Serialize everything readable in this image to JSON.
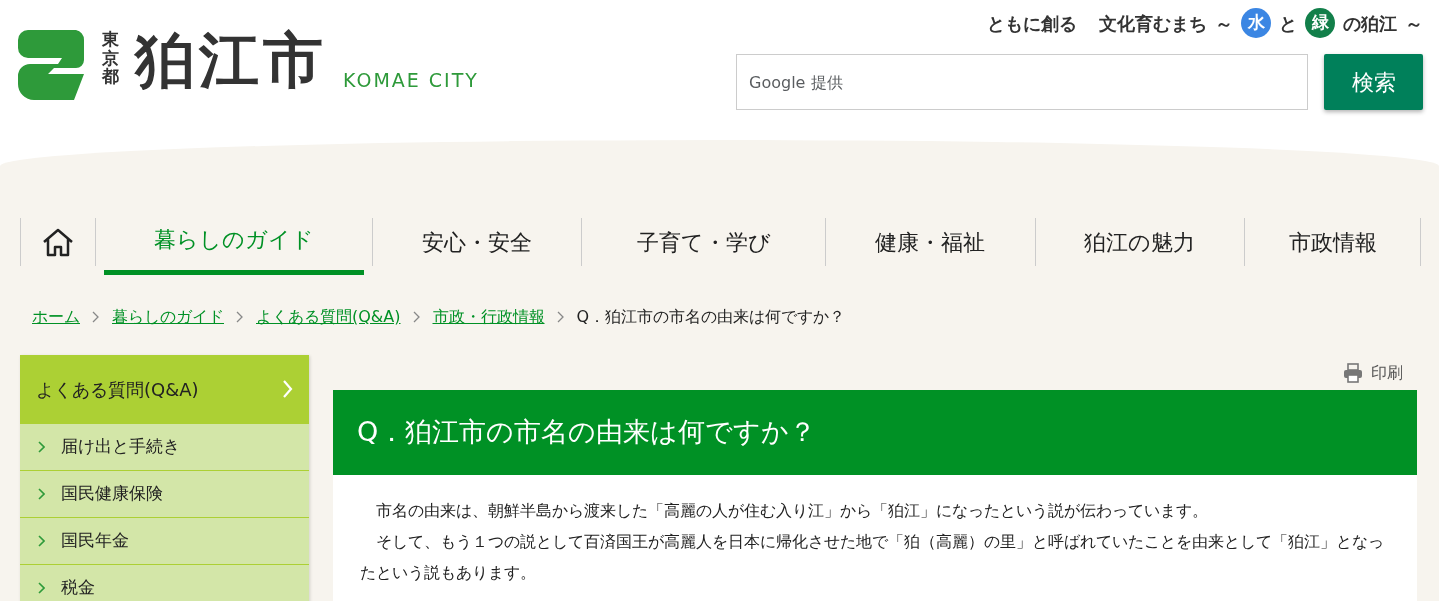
{
  "header": {
    "prefecture": "東京都",
    "city": "狛江市",
    "city_en": "KOMAE CITY",
    "slogan": [
      {
        "kind": "text",
        "text": "ともに創る"
      },
      {
        "kind": "text",
        "text": "文化育むまち"
      },
      {
        "kind": "text",
        "text": "～"
      },
      {
        "kind": "circle",
        "text": "水",
        "color": "#3b86e3"
      },
      {
        "kind": "text",
        "text": "と"
      },
      {
        "kind": "circle",
        "text": "緑",
        "color": "#127f4a"
      },
      {
        "kind": "text",
        "text": "の狛江"
      },
      {
        "kind": "text",
        "text": "～"
      }
    ],
    "search": {
      "placeholder": "Google 提供",
      "button": "検索"
    }
  },
  "nav": [
    {
      "kind": "home"
    },
    {
      "kind": "text",
      "label": "暮らしのガイド",
      "selected": true
    },
    {
      "kind": "text",
      "label": "安心・安全",
      "selected": false
    },
    {
      "kind": "text",
      "label": "子育て・学び",
      "selected": false
    },
    {
      "kind": "text",
      "label": "健康・福祉",
      "selected": false
    },
    {
      "kind": "text",
      "label": "狛江の魅力",
      "selected": false
    },
    {
      "kind": "text",
      "label": "市政情報",
      "selected": false
    }
  ],
  "breadcrumb": [
    {
      "label": "ホーム",
      "link": true
    },
    {
      "label": "暮らしのガイド",
      "link": true
    },
    {
      "label": "よくある質問(Q&A)",
      "link": true
    },
    {
      "label": "市政・行政情報",
      "link": true
    },
    {
      "label": "Q．狛江市の市名の由来は何ですか？",
      "link": false
    }
  ],
  "sidebar": {
    "title": "よくある質問(Q&A)",
    "items": [
      "届け出と手続き",
      "国民健康保険",
      "国民年金",
      "税金"
    ]
  },
  "print": "印刷",
  "article": {
    "title": "Q．狛江市の市名の由来は何ですか？",
    "paragraphs": [
      "市名の由来は、朝鮮半島から渡来した「高麗の人が住む入り江」から「狛江」になったという説が伝わっています。",
      "そして、もう１つの説として百済国王が高麗人を日本に帰化させた地で「狛（高麗）の里」と呼ばれていたことを由来として「狛江」となったという説もあります。"
    ]
  }
}
